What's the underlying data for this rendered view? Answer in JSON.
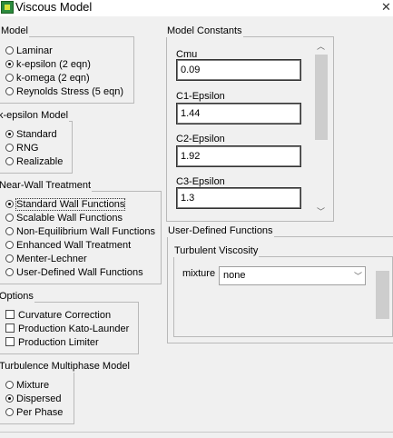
{
  "window": {
    "title": "Viscous Model",
    "close_glyph": "✕"
  },
  "model": {
    "label": "Model",
    "options": [
      {
        "label": "Laminar",
        "selected": false
      },
      {
        "label": "k-epsilon (2 eqn)",
        "selected": true
      },
      {
        "label": "k-omega (2 eqn)",
        "selected": false
      },
      {
        "label": "Reynolds Stress (5 eqn)",
        "selected": false
      }
    ]
  },
  "k_epsilon_model": {
    "label": "k-epsilon Model",
    "options": [
      {
        "label": "Standard",
        "selected": true
      },
      {
        "label": "RNG",
        "selected": false
      },
      {
        "label": "Realizable",
        "selected": false
      }
    ]
  },
  "near_wall": {
    "label": "Near-Wall Treatment",
    "options": [
      {
        "label": "Standard Wall Functions",
        "selected": true
      },
      {
        "label": "Scalable Wall Functions",
        "selected": false
      },
      {
        "label": "Non-Equilibrium Wall Functions",
        "selected": false
      },
      {
        "label": "Enhanced Wall Treatment",
        "selected": false
      },
      {
        "label": "Menter-Lechner",
        "selected": false
      },
      {
        "label": "User-Defined Wall Functions",
        "selected": false
      }
    ]
  },
  "options": {
    "label": "Options",
    "items": [
      {
        "label": "Curvature Correction",
        "checked": false
      },
      {
        "label": "Production Kato-Launder",
        "checked": false
      },
      {
        "label": "Production Limiter",
        "checked": false
      }
    ]
  },
  "multiphase": {
    "label": "Turbulence Multiphase Model",
    "options": [
      {
        "label": "Mixture",
        "selected": false
      },
      {
        "label": "Dispersed",
        "selected": true
      },
      {
        "label": "Per Phase",
        "selected": false
      }
    ]
  },
  "model_constants": {
    "label": "Model Constants",
    "fields": [
      {
        "label": "Cmu",
        "value": "0.09"
      },
      {
        "label": "C1-Epsilon",
        "value": "1.44"
      },
      {
        "label": "C2-Epsilon",
        "value": "1.92"
      },
      {
        "label": "C3-Epsilon",
        "value": "1.3"
      }
    ]
  },
  "user_defined": {
    "label": "User-Defined Functions",
    "turbulent_viscosity": {
      "label": "Turbulent Viscosity",
      "row_label": "mixture",
      "selected": "none"
    }
  }
}
